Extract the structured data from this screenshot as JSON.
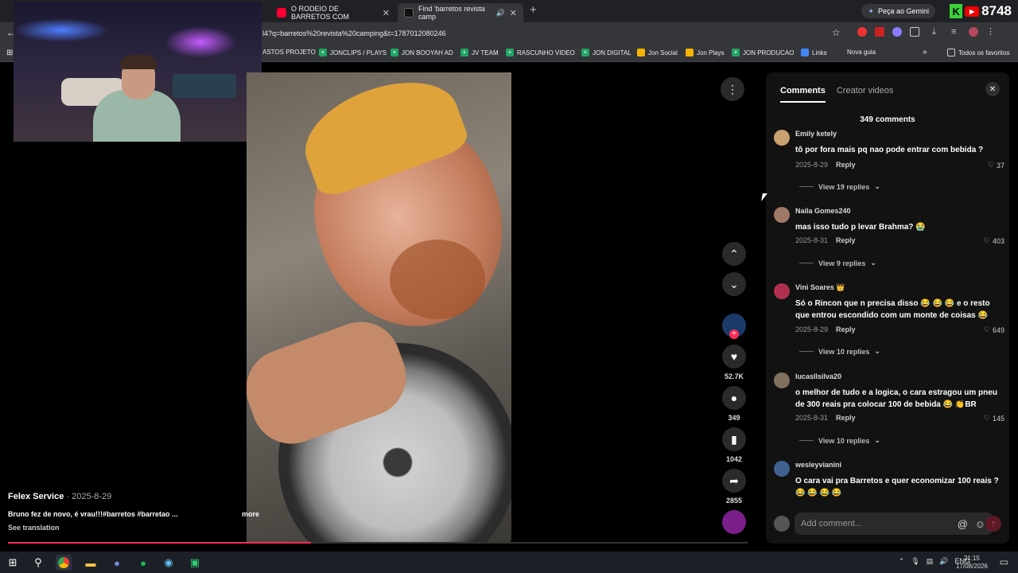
{
  "browser": {
    "tabs": [
      {
        "title": "O RODEIO DE BARRETOS COM",
        "color": "#ff0033"
      },
      {
        "title": "Find 'barretos revista camp",
        "color": "#111111"
      }
    ],
    "gemini_label": "Peça ao Gemini",
    "k_counter": "8748",
    "url": "l4?q=barretos%20revista%20camping&t=1787012080246",
    "bookmarks": [
      "ASTOS PROJETO",
      "JONCLIPS / PLAYS",
      "JON BOOYAH AD",
      "JV TEAM",
      "RASCUNHO VIDEO",
      "JON DIGITAL",
      "Jon Social",
      "Jon Plays",
      "JON PRODUCAO",
      "Links",
      "Nova guia",
      "Todos os favoritos"
    ]
  },
  "video": {
    "author": "Felex Service",
    "date": "· 2025-8-29",
    "caption": "Bruno fez de novo, é vrau!!!#barretos #barretao ...",
    "more": "more",
    "see_translation": "See translation",
    "progress": 0.41,
    "likes": "52.7K",
    "comments": "349",
    "saves": "1042",
    "shares": "2855"
  },
  "panel": {
    "tab_comments": "Comments",
    "tab_creator": "Creator videos",
    "count": "349 comments",
    "comments": [
      {
        "name": "Emily ketely",
        "text": "tô por fora mais pq nao pode entrar com bebida ?",
        "date": "2025-8-29",
        "reply": "Reply",
        "likes": "37",
        "replies": "View 19 replies",
        "avatar": "#c9a070"
      },
      {
        "name": "Naila Gomes240",
        "text": "mas isso tudo p levar Brahma? 😭",
        "date": "2025-8-31",
        "reply": "Reply",
        "likes": "403",
        "replies": "View 9 replies",
        "avatar": "#a07868"
      },
      {
        "name": "Vini Soares 👑",
        "text": "Só o Rincon que n precisa disso 😂 😂 😂  e o resto que entrou escondido com um monte de coisas 😂",
        "date": "2025-8-29",
        "reply": "Reply",
        "likes": "649",
        "replies": "View 10 replies",
        "avatar": "#b03050"
      },
      {
        "name": "lucasllsilva20",
        "text": "o melhor de tudo e a logica, o cara estragou um pneu de 300 reais pra colocar 100 de bebida 😂 👏BR",
        "date": "2025-8-31",
        "reply": "Reply",
        "likes": "145",
        "replies": "View 10 replies",
        "avatar": "#807060"
      },
      {
        "name": "wesleyvianini",
        "text": "O cara vai pra Barretos e quer economizar 100 reais ? 😂 😂 😂 😂",
        "avatar": "#406090"
      }
    ],
    "add_comment": "Add comment...",
    "at_icon": "@",
    "emoji_icon": "☺"
  },
  "taskbar": {
    "lang": "ENG",
    "time": "21:15",
    "date": "17/08/2026"
  }
}
